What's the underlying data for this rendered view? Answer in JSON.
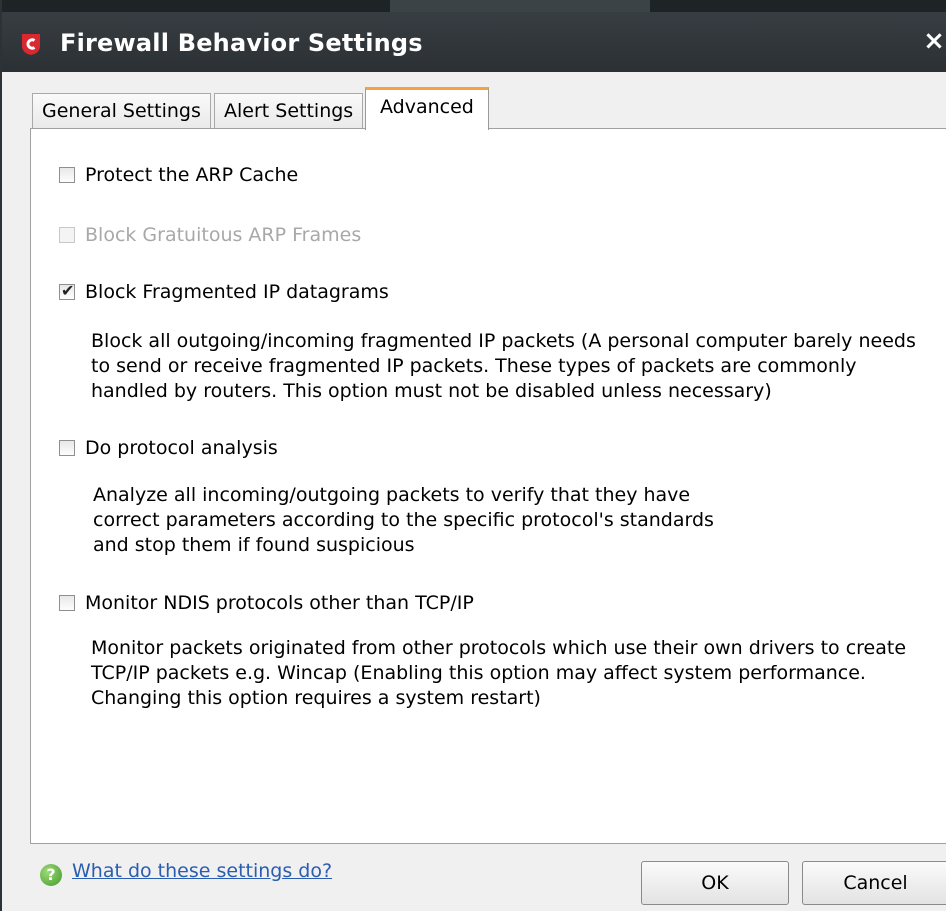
{
  "window": {
    "title": "Firewall Behavior Settings",
    "close_symbol": "×",
    "accent_color": "#f5a340",
    "logo_color": "#d9282f"
  },
  "tabs": [
    {
      "label": "General Settings",
      "active": false
    },
    {
      "label": "Alert Settings",
      "active": false
    },
    {
      "label": "Advanced",
      "active": true
    }
  ],
  "options": [
    {
      "label": "Protect the ARP Cache",
      "checked": false,
      "enabled": true,
      "description": ""
    },
    {
      "label": "Block Gratuitous ARP Frames",
      "checked": false,
      "enabled": false,
      "description": ""
    },
    {
      "label": "Block Fragmented IP datagrams",
      "checked": true,
      "enabled": true,
      "description": "Block all outgoing/incoming fragmented IP packets (A personal computer barely needs\nto send or receive fragmented IP packets. These types of packets are commonly\nhandled by routers. This option must not be disabled unless necessary)"
    },
    {
      "label": "Do protocol analysis",
      "checked": false,
      "enabled": true,
      "description": "Analyze all incoming/outgoing packets to verify that they have\ncorrect parameters according to the specific protocol's standards\nand stop them if found suspicious"
    },
    {
      "label": "Monitor NDIS protocols other than TCP/IP",
      "checked": false,
      "enabled": true,
      "description": "Monitor packets originated from other protocols which use their own drivers to create\nTCP/IP packets e.g. Wincap (Enabling this option may affect system performance.\nChanging this option requires a system restart)"
    }
  ],
  "footer": {
    "help_link": "What do these settings do?",
    "help_icon": "help-question-icon",
    "ok_label": "OK",
    "cancel_label": "Cancel"
  }
}
